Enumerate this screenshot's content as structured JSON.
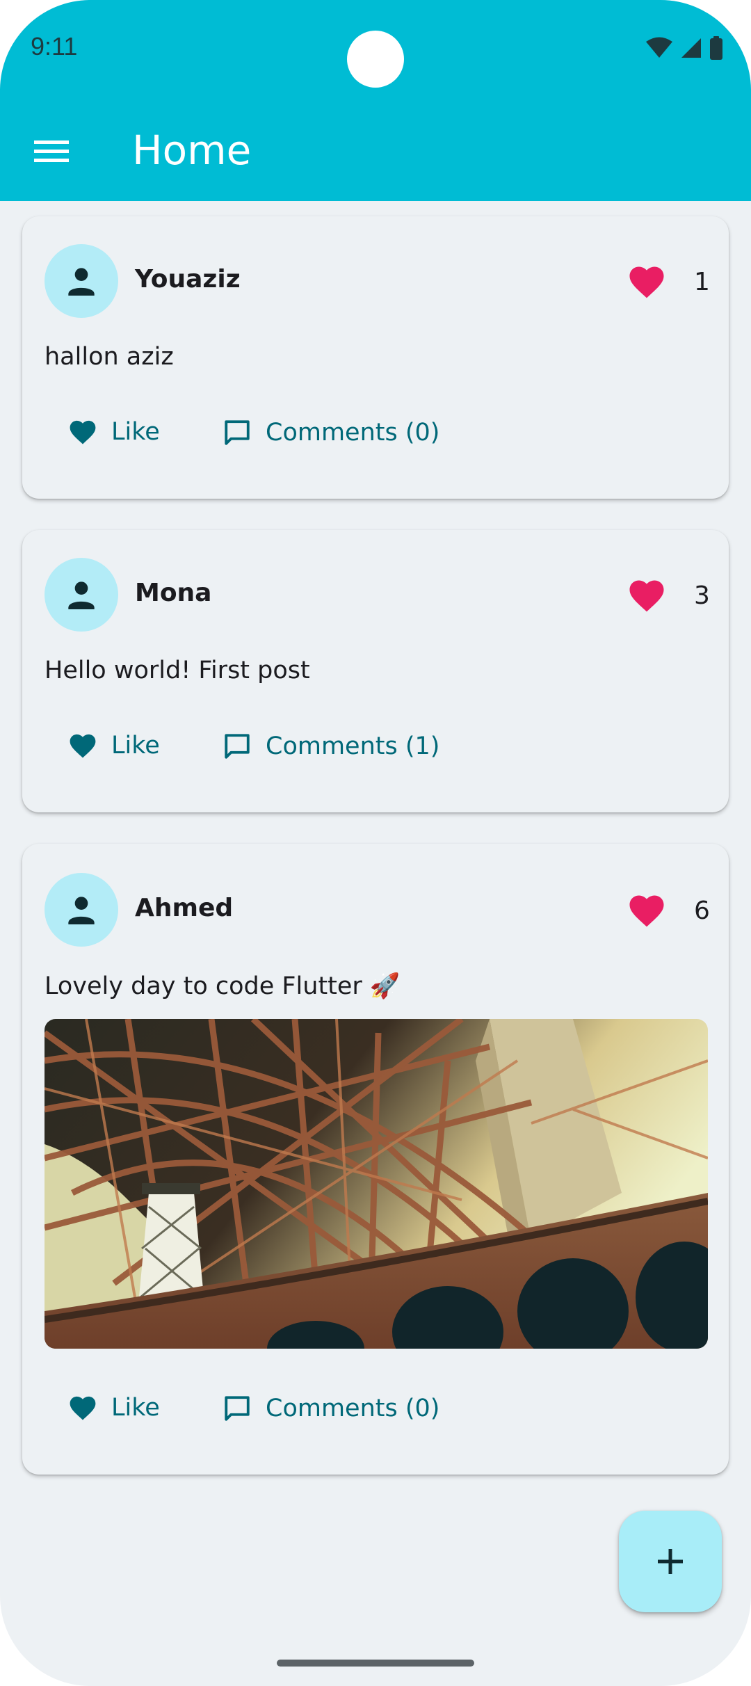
{
  "status_bar": {
    "time": "9:11"
  },
  "app_bar": {
    "title": "Home",
    "menu_icon": "hamburger-menu-icon"
  },
  "posts": [
    {
      "author": "Youaziz",
      "likes": "1",
      "text": "hallon aziz",
      "has_image": false,
      "like_label": "Like",
      "comments_label": "Comments (0)"
    },
    {
      "author": "Mona",
      "likes": "3",
      "text": "Hello world! First post",
      "has_image": false,
      "like_label": "Like",
      "comments_label": "Comments (1)"
    },
    {
      "author": "Ahmed",
      "likes": "6",
      "text": "Lovely day to code Flutter 🚀",
      "has_image": true,
      "like_label": "Like",
      "comments_label": "Comments (0)"
    }
  ],
  "fab": {
    "icon": "plus-icon"
  },
  "colors": {
    "app_bar": "#00bcd4",
    "background": "#edf1f4",
    "heart": "#e91e63",
    "action": "#006878",
    "avatar_bg": "#b3ecf7",
    "fab_bg": "#a8edf8"
  }
}
